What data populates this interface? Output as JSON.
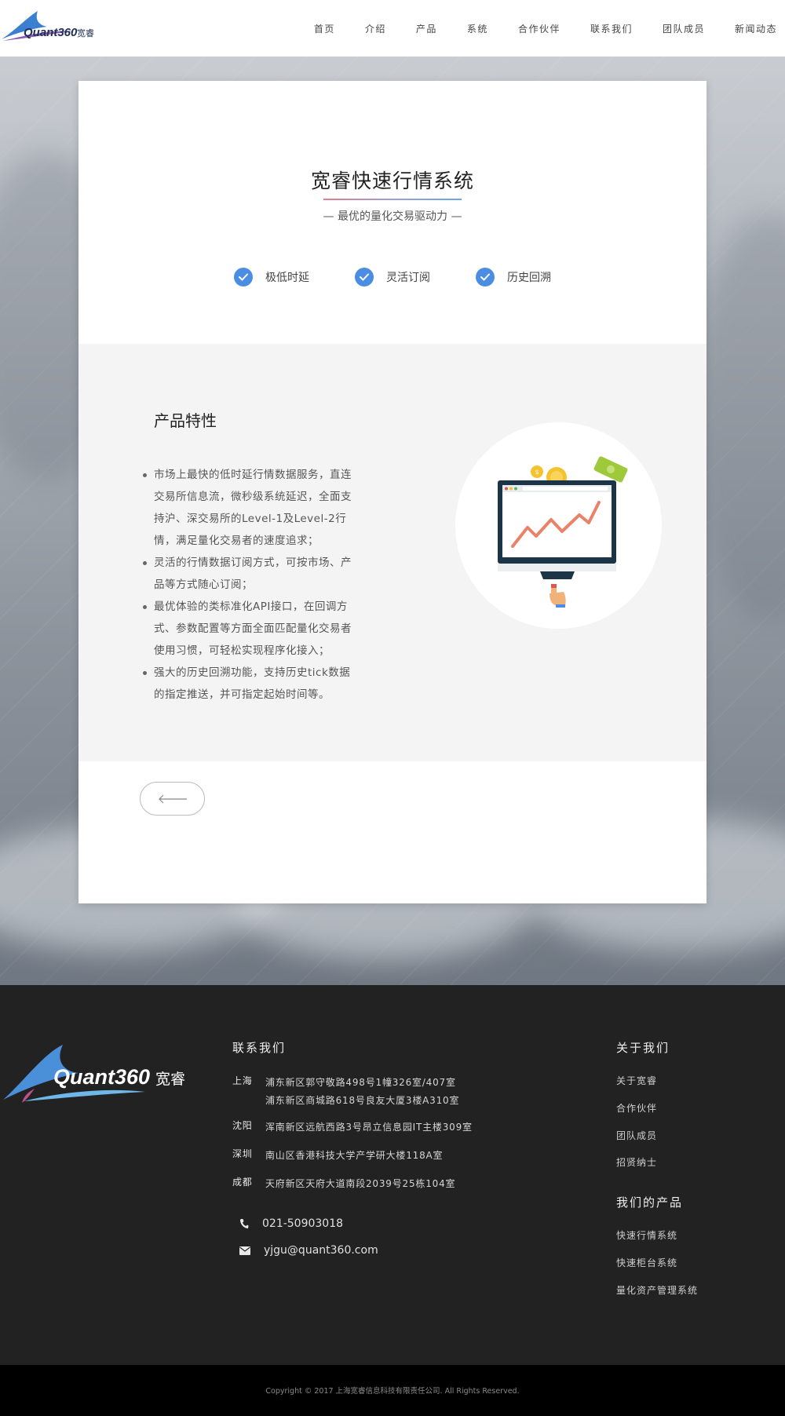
{
  "header": {
    "logo_text": "Quant360宽睿",
    "nav": [
      "首页",
      "介绍",
      "产品",
      "系统",
      "合作伙伴",
      "联系我们",
      "团队成员",
      "新闻动态"
    ]
  },
  "card": {
    "title": "宽睿快速行情系统",
    "subtitle": "— 最优的量化交易驱动力 —",
    "features": [
      "极低时延",
      "灵活订阅",
      "历史回溯"
    ],
    "section_title": "产品特性",
    "bullets": [
      [
        "市场上最快的低时延行情数据服务，直连",
        "交易所信息流，微秒级系统延迟，全面支",
        "持沪、深交易所的Level-1及Level-2行",
        "情，满足量化交易者的速度追求；"
      ],
      [
        "灵活的行情数据订阅方式，可按市场、产",
        "品等方式随心订阅；"
      ],
      [
        "最优体验的类标准化API接口，在回调方",
        "式、参数配置等方面全面匹配量化交易者",
        "使用习惯，可轻松实现程序化接入；"
      ],
      [
        "强大的历史回溯功能，支持历史tick数据",
        "的指定推送，并可指定起始时间等。"
      ]
    ]
  },
  "footer": {
    "logo_text": "Quant360宽睿",
    "contact": {
      "title": "联系我们",
      "offices": [
        {
          "city": "上海",
          "lines": [
            "浦东新区郭守敬路498号1幢326室/407室",
            "浦东新区商城路618号良友大厦3楼A310室"
          ]
        },
        {
          "city": "沈阳",
          "lines": [
            "浑南新区远航西路3号昂立信息园IT主楼309室"
          ]
        },
        {
          "city": "深圳",
          "lines": [
            "南山区香港科技大学产学研大楼118A室"
          ]
        },
        {
          "city": "成都",
          "lines": [
            "天府新区天府大道南段2039号25栋104室"
          ]
        }
      ],
      "phone": "021-50903018",
      "email": "yjgu@quant360.com"
    },
    "about": {
      "title": "关于我们",
      "links": [
        "关于宽睿",
        "合作伙伴",
        "团队成员",
        "招贤纳士"
      ]
    },
    "products": {
      "title": "我们的产品",
      "links": [
        "快速行情系统",
        "快速柜台系统",
        "量化资产管理系统"
      ]
    },
    "copyright": "Copyright © 2017 上海宽睿信息科技有限责任公司. All Rights Reserved."
  },
  "colors": {
    "accent_blue": "#4a8de3",
    "footer_bg": "#222223",
    "card_gray": "#f4f4f5"
  }
}
